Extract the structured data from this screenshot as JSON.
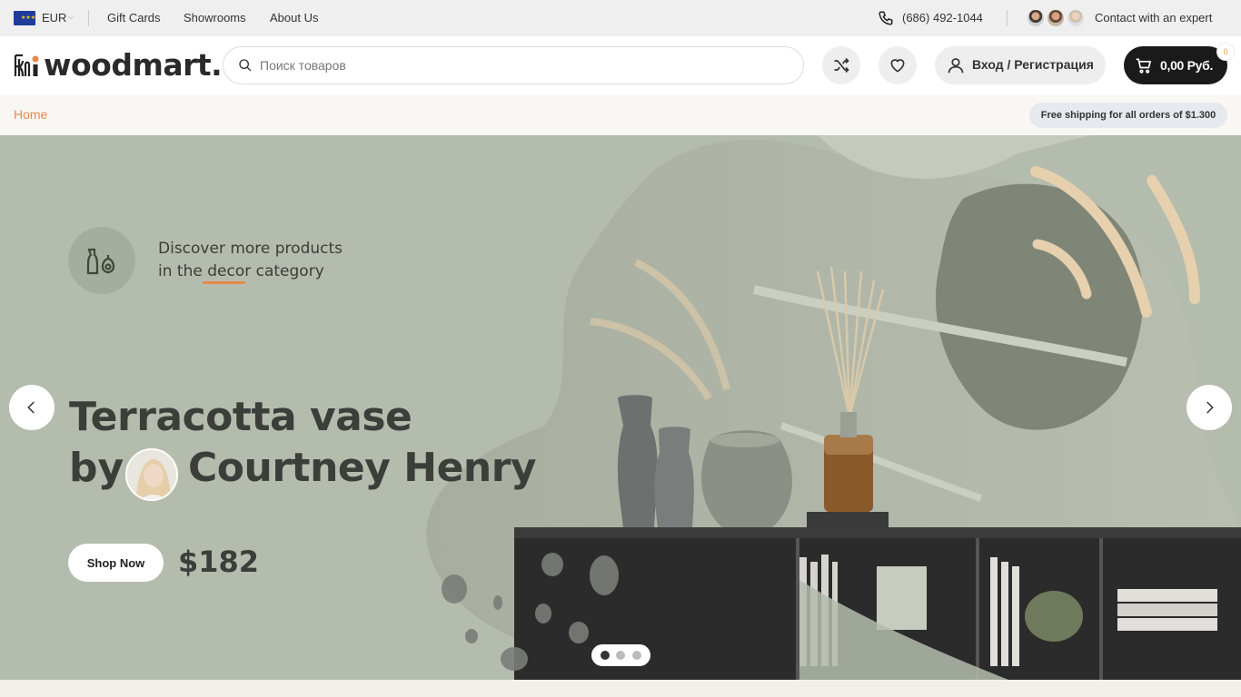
{
  "topbar": {
    "currency": "EUR",
    "links": [
      "Gift Cards",
      "Showrooms",
      "About Us"
    ],
    "phone": "(686) 492-1044",
    "contact": "Contact with an expert"
  },
  "header": {
    "logo": "woodmart.",
    "search_placeholder": "Поиск товаров",
    "login": "Вход / Регистрация",
    "cart_total": "0,00 Руб.",
    "cart_count": "0"
  },
  "breadcrumb": {
    "home": "Home",
    "shipping_notice": "Free shipping for all orders of $1.300"
  },
  "hero": {
    "category_line1": "Discover more products",
    "category_line2_pre": "in the ",
    "category_keyword": "decor",
    "category_line2_post": " category",
    "title_line1": "Terracotta vase",
    "title_by": "by",
    "author": "Courtney Henry",
    "cta": "Shop Now",
    "price": "$182",
    "active_slide": 1,
    "slide_count": 3
  },
  "colors": {
    "accent": "#e8884b",
    "hero_bg": "#b4bcae",
    "dark": "#1a1a1a"
  }
}
